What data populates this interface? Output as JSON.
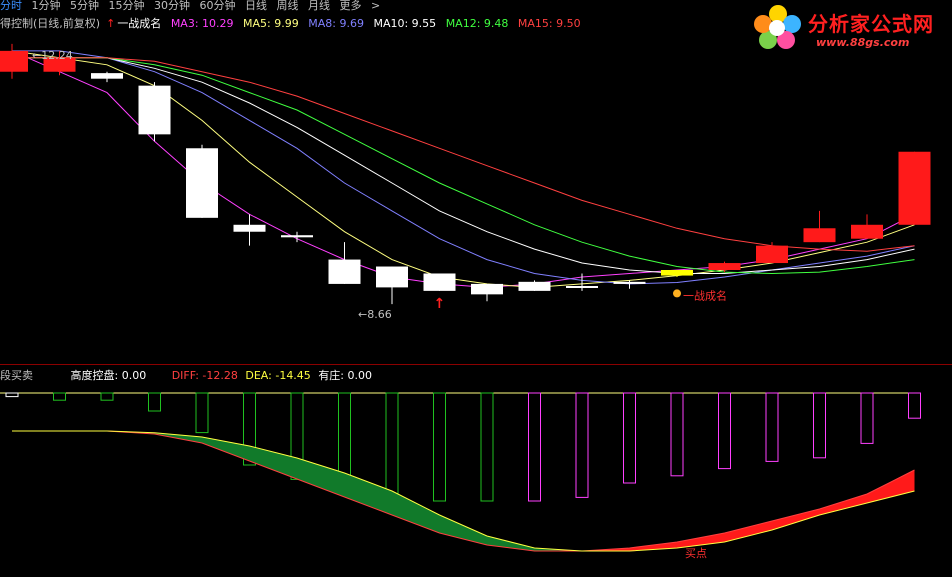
{
  "toolbar": {
    "items": [
      "分时",
      "1分钟",
      "5分钟",
      "15分钟",
      "30分钟",
      "60分钟",
      "日线",
      "周线",
      "月线",
      "更多"
    ],
    "more_symbol": ">"
  },
  "main_legend": {
    "title": "得控制(日线,前复权)",
    "signal": "一战成名",
    "ma": [
      {
        "label": "MA3: 10.29",
        "color": "#ff40ff"
      },
      {
        "label": "MA5: 9.99",
        "color": "#ffff80"
      },
      {
        "label": "MA8: 9.69",
        "color": "#8080ff"
      },
      {
        "label": "MA10: 9.55",
        "color": "#ffffff"
      },
      {
        "label": "MA12: 9.48",
        "color": "#40ff40"
      },
      {
        "label": "MA15: 9.50",
        "color": "#ff4040"
      }
    ]
  },
  "sub_legend": {
    "title": "段买卖",
    "items": [
      {
        "label": "高度控盘: 0.00",
        "color": "#ffffff"
      },
      {
        "label": "DIFF: -12.28",
        "color": "#ff4040"
      },
      {
        "label": "DEA: -14.45",
        "color": "#ffff40"
      },
      {
        "label": "有庄: 0.00",
        "color": "#ffffff"
      }
    ]
  },
  "logo": {
    "title": "分析家公式网",
    "url": "www.88gs.com"
  },
  "chart_data": {
    "type": "candlestick",
    "price_range": [
      8.0,
      12.6
    ],
    "annotations": {
      "high_label": "12.24",
      "low_label": "8.66",
      "signal_text": "一战成名",
      "sub_text": "买点"
    },
    "candles": [
      {
        "open": 12.0,
        "close": 12.3,
        "high": 12.4,
        "low": 11.9,
        "color": "red"
      },
      {
        "open": 12.2,
        "close": 12.0,
        "high": 12.3,
        "low": 11.95,
        "color": "red"
      },
      {
        "open": 11.98,
        "close": 11.9,
        "high": 12.0,
        "low": 11.85,
        "color": "white"
      },
      {
        "open": 11.8,
        "close": 11.1,
        "high": 11.85,
        "low": 11.0,
        "color": "white"
      },
      {
        "open": 10.9,
        "close": 9.9,
        "high": 10.95,
        "low": 9.9,
        "color": "white"
      },
      {
        "open": 9.8,
        "close": 9.7,
        "high": 9.95,
        "low": 9.5,
        "color": "white"
      },
      {
        "open": 9.65,
        "close": 9.62,
        "high": 9.7,
        "low": 9.55,
        "color": "white"
      },
      {
        "open": 9.3,
        "close": 8.95,
        "high": 9.55,
        "low": 8.95,
        "color": "white"
      },
      {
        "open": 9.2,
        "close": 8.9,
        "high": 9.2,
        "low": 8.66,
        "color": "white"
      },
      {
        "open": 9.1,
        "close": 8.85,
        "high": 9.1,
        "low": 8.85,
        "color": "white"
      },
      {
        "open": 8.95,
        "close": 8.8,
        "high": 8.95,
        "low": 8.7,
        "color": "white"
      },
      {
        "open": 8.98,
        "close": 8.85,
        "high": 9.0,
        "low": 8.85,
        "color": "white"
      },
      {
        "open": 8.92,
        "close": 8.92,
        "high": 9.1,
        "low": 8.85,
        "color": "white"
      },
      {
        "open": 8.98,
        "close": 8.95,
        "high": 9.0,
        "low": 8.88,
        "color": "white"
      },
      {
        "open": 9.07,
        "close": 9.15,
        "high": 9.15,
        "low": 9.05,
        "color": "yellow"
      },
      {
        "open": 9.15,
        "close": 9.25,
        "high": 9.27,
        "low": 9.12,
        "color": "red"
      },
      {
        "open": 9.25,
        "close": 9.5,
        "high": 9.55,
        "low": 9.25,
        "color": "red"
      },
      {
        "open": 9.55,
        "close": 9.75,
        "high": 10.0,
        "low": 9.55,
        "color": "red"
      },
      {
        "open": 9.6,
        "close": 9.8,
        "high": 9.95,
        "low": 9.6,
        "color": "red"
      },
      {
        "open": 9.8,
        "close": 10.85,
        "high": 10.85,
        "low": 9.8,
        "color": "red"
      }
    ],
    "ma_series": [
      {
        "name": "MA3",
        "color": "#ff40ff",
        "values": [
          12.3,
          12.0,
          11.7,
          11.0,
          10.4,
          9.95,
          9.6,
          9.3,
          9.05,
          8.95,
          8.9,
          8.95,
          9.05,
          9.1,
          9.15,
          9.2,
          9.3,
          9.45,
          9.6,
          9.95
        ]
      },
      {
        "name": "MA5",
        "color": "#ffff80",
        "values": [
          12.3,
          12.2,
          12.1,
          11.8,
          11.3,
          10.7,
          10.2,
          9.7,
          9.3,
          9.05,
          8.95,
          8.9,
          8.95,
          9.0,
          9.07,
          9.15,
          9.25,
          9.4,
          9.55,
          9.8
        ]
      },
      {
        "name": "MA8",
        "color": "#8080ff",
        "values": [
          12.3,
          12.3,
          12.2,
          12.0,
          11.7,
          11.3,
          10.9,
          10.4,
          10.0,
          9.6,
          9.3,
          9.1,
          9.0,
          8.95,
          8.97,
          9.05,
          9.15,
          9.25,
          9.35,
          9.5
        ]
      },
      {
        "name": "MA10",
        "color": "#ffffff",
        "values": [
          12.2,
          12.2,
          12.2,
          12.05,
          11.85,
          11.55,
          11.2,
          10.8,
          10.4,
          10.0,
          9.7,
          9.45,
          9.25,
          9.15,
          9.1,
          9.1,
          9.15,
          9.2,
          9.3,
          9.45
        ]
      },
      {
        "name": "MA12",
        "color": "#40ff40",
        "values": [
          12.2,
          12.2,
          12.2,
          12.1,
          11.95,
          11.7,
          11.45,
          11.1,
          10.75,
          10.4,
          10.1,
          9.8,
          9.55,
          9.35,
          9.2,
          9.12,
          9.1,
          9.12,
          9.2,
          9.3
        ]
      },
      {
        "name": "MA15",
        "color": "#ff4040",
        "values": [
          12.2,
          12.2,
          12.2,
          12.15,
          12.0,
          11.85,
          11.65,
          11.4,
          11.15,
          10.9,
          10.65,
          10.4,
          10.15,
          9.95,
          9.75,
          9.6,
          9.5,
          9.45,
          9.42,
          9.5
        ]
      }
    ],
    "sub_bars": [
      {
        "value": -0.05,
        "color": "white"
      },
      {
        "value": -0.1,
        "color": "green"
      },
      {
        "value": -0.1,
        "color": "green"
      },
      {
        "value": -0.25,
        "color": "green"
      },
      {
        "value": -0.55,
        "color": "green"
      },
      {
        "value": -1.0,
        "color": "green"
      },
      {
        "value": -1.2,
        "color": "green"
      },
      {
        "value": -1.25,
        "color": "green"
      },
      {
        "value": -1.45,
        "color": "green"
      },
      {
        "value": -1.5,
        "color": "green"
      },
      {
        "value": -1.5,
        "color": "green"
      },
      {
        "value": -1.5,
        "color": "magenta"
      },
      {
        "value": -1.45,
        "color": "magenta"
      },
      {
        "value": -1.25,
        "color": "magenta"
      },
      {
        "value": -1.15,
        "color": "magenta"
      },
      {
        "value": -1.05,
        "color": "magenta"
      },
      {
        "value": -0.95,
        "color": "magenta"
      },
      {
        "value": -0.9,
        "color": "magenta"
      },
      {
        "value": -0.7,
        "color": "magenta"
      },
      {
        "value": -0.35,
        "color": "magenta"
      }
    ],
    "diff": [
      -0.55,
      -0.55,
      -0.55,
      -0.6,
      -0.75,
      -1.05,
      -1.35,
      -1.65,
      -1.95,
      -2.25,
      -2.45,
      -2.55,
      -2.55,
      -2.5,
      -2.4,
      -2.25,
      -2.05,
      -1.85,
      -1.6,
      -1.2
    ],
    "dea": [
      -0.55,
      -0.55,
      -0.55,
      -0.58,
      -0.65,
      -0.8,
      -1.0,
      -1.25,
      -1.55,
      -1.95,
      -2.3,
      -2.5,
      -2.55,
      -2.55,
      -2.5,
      -2.4,
      -2.2,
      -1.95,
      -1.75,
      -1.55
    ]
  }
}
